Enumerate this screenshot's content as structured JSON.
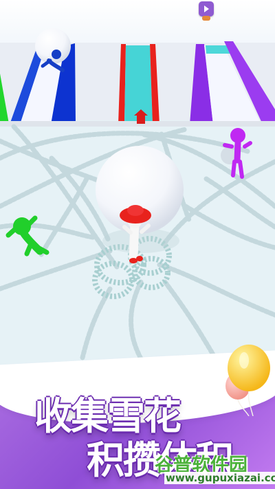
{
  "game": {
    "headline": [
      "收集雪花",
      "积攒体积"
    ],
    "watermark": {
      "name": "谷普软件园",
      "url": "www.gupuxiazai.com"
    },
    "icons": [
      "play-menu-icon",
      "balloon-icon",
      "snowball-icon",
      "player-character-icon"
    ],
    "colors": {
      "ice_lane": "#45d6d8",
      "blue_lane": "#1d4bdc",
      "purple_lane": "#8a2ee6",
      "green_opponent": "#21cf2b",
      "purple_opponent": "#b42af0",
      "red_hat": "#e8221d",
      "promo": "#9b59dc"
    }
  }
}
